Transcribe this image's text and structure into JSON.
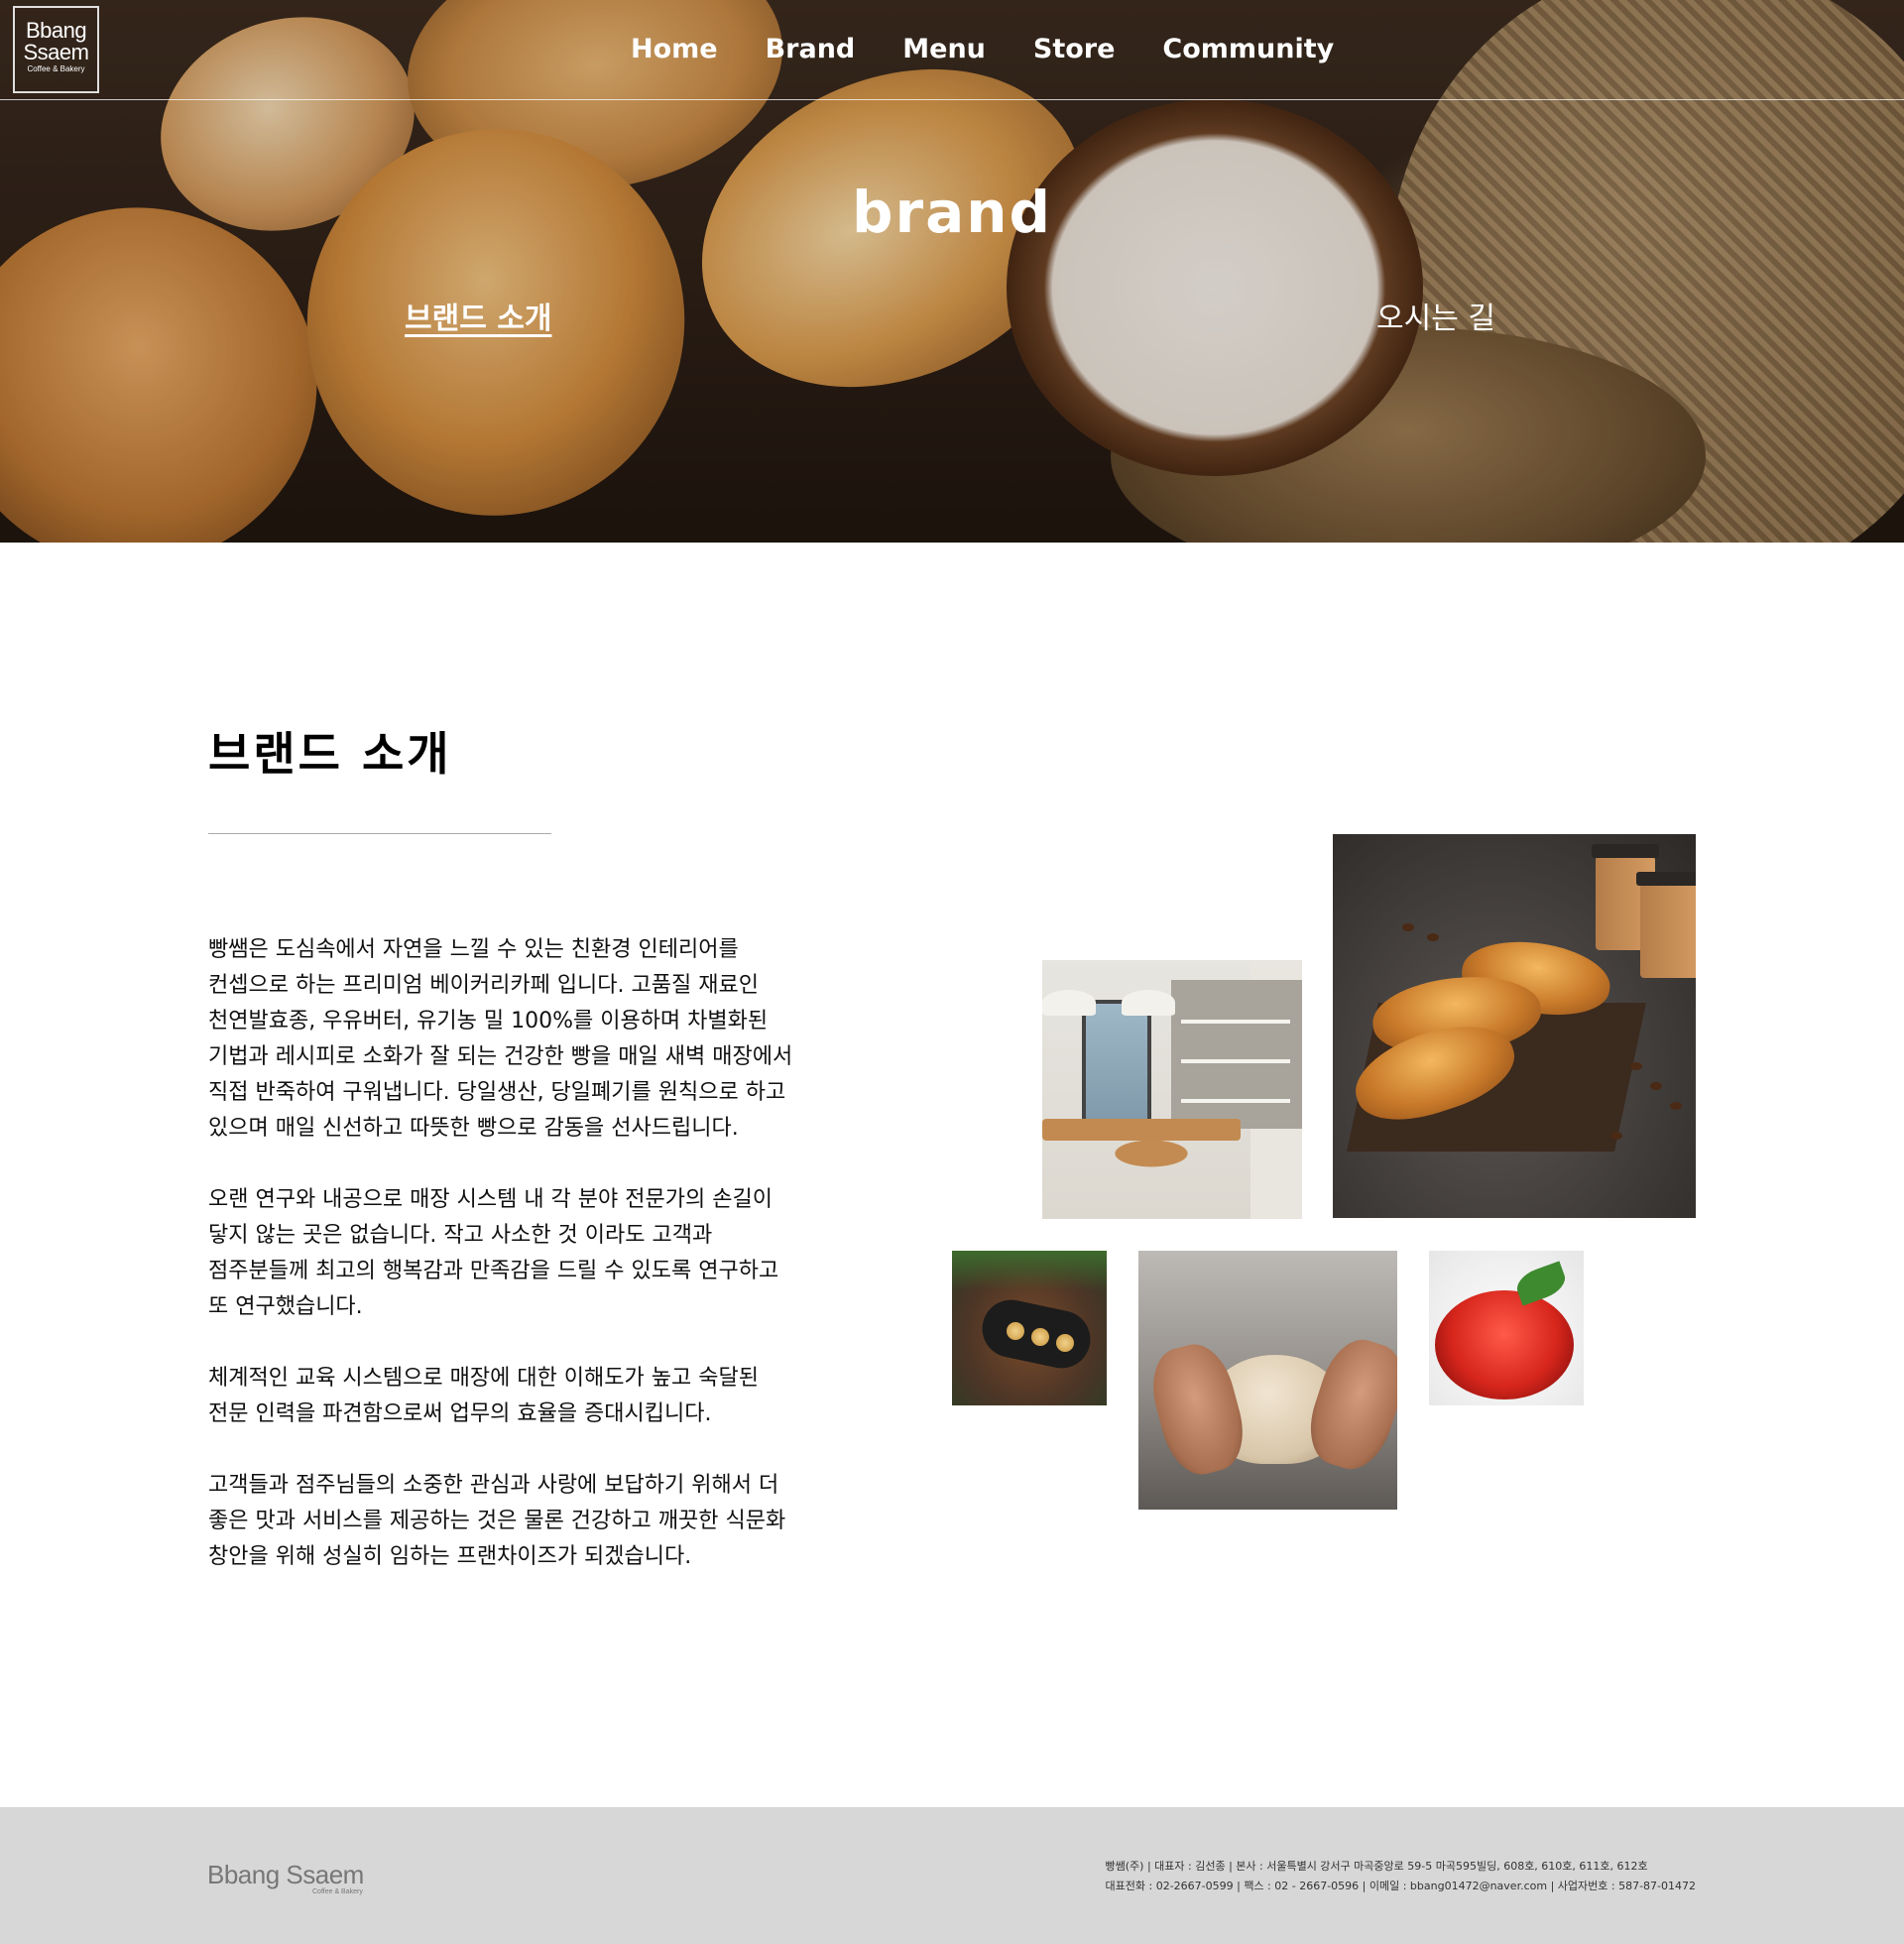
{
  "header": {
    "logo_line1": "Bbang",
    "logo_line2": "Ssaem",
    "logo_tagline": "Coffee & Bakery",
    "nav": [
      "Home",
      "Brand",
      "Menu",
      "Store",
      "Community"
    ]
  },
  "hero": {
    "title": "brand",
    "tabs": [
      "브랜드 소개",
      "오시는 길"
    ]
  },
  "main": {
    "title": "브랜드 소개",
    "paragraphs": [
      "빵쌤은 도심속에서 자연을 느낄 수 있는 친환경 인테리어를 컨셉으로 하는 프리미엄 베이커리카페 입니다. 고품질 재료인 천연발효종, 우유버터, 유기농 밀 100%를 이용하며 차별화된 기법과 레시피로 소화가 잘 되는 건강한 빵을 매일 새벽 매장에서 직접 반죽하여 구워냅니다. 당일생산, 당일폐기를 원칙으로 하고 있으며 매일 신선하고 따뜻한 빵으로 감동을 선사드립니다.",
      "오랜 연구와 내공으로 매장 시스템 내 각 분야 전문가의 손길이 닿지 않는 곳은 없습니다. 작고 사소한 것 이라도 고객과 점주분들께 최고의 행복감과 만족감을 드릴 수 있도록 연구하고 또 연구했습니다.",
      "체계적인 교육 시스템으로 매장에 대한 이해도가 높고 숙달된 전문 인력을 파견함으로써 업무의 효율을 증대시킵니다.",
      "고객들과 점주님들의 소중한 관심과 사랑에 보답하기 위해서 더 좋은 맛과 서비스를 제공하는 것은 물론 건강하고 깨끗한 식문화 창안을 위해 성실히 임하는 프랜차이즈가 되겠습니다."
    ]
  },
  "footer": {
    "logo": "Bbang Ssaem",
    "logo_tagline": "Coffee & Bakery",
    "info_line1": "빵쌤(주) | 대표자 : 김선종 | 본사 : 서울특별시 강서구 마곡중앙로 59-5 마곡595빌딩, 608호, 610호, 611호, 612호",
    "info_line2": "대표전화 : 02-2667-0599 | 팩스 : 02 - 2667-0596 | 이메일 : bbang01472@naver.com | 사업자번호 : 587-87-01472"
  }
}
